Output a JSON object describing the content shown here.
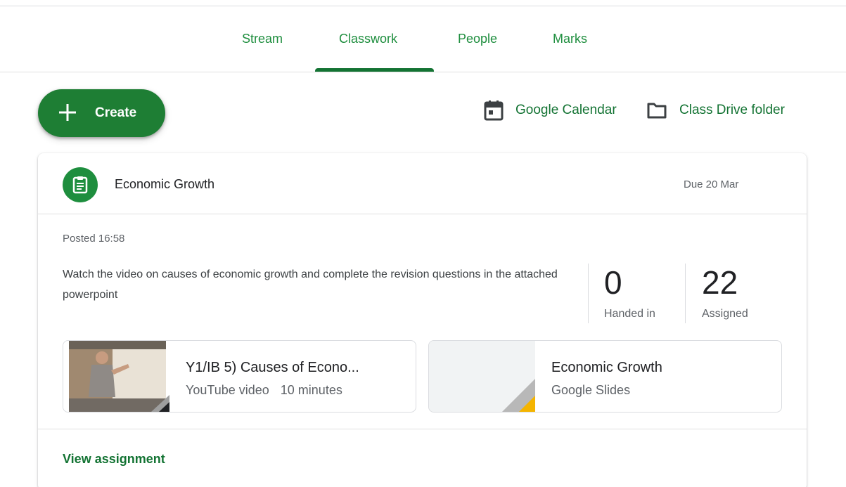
{
  "tabs": [
    {
      "label": "Stream"
    },
    {
      "label": "Classwork",
      "active": true
    },
    {
      "label": "People"
    },
    {
      "label": "Marks"
    }
  ],
  "toolbar": {
    "create_label": "Create",
    "calendar_label": "Google Calendar",
    "drive_label": "Class Drive folder"
  },
  "assignment": {
    "icon": "assignment-icon",
    "title": "Economic Growth",
    "due": "Due 20 Mar",
    "posted": "Posted 16:58",
    "description": "Watch the video on causes of economic growth and complete the revision questions in the attached powerpoint",
    "stats": {
      "handed_in_count": "0",
      "handed_in_label": "Handed in",
      "assigned_count": "22",
      "assigned_label": "Assigned"
    },
    "attachments": [
      {
        "title": "Y1/IB 5) Causes of Econo...",
        "type": "YouTube video",
        "duration": "10 minutes",
        "icon": "youtube-thumbnail"
      },
      {
        "title": "Economic Growth",
        "type": "Google Slides",
        "icon": "slides-thumbnail"
      }
    ],
    "view_label": "View assignment"
  },
  "colors": {
    "brand_green": "#1e7e34",
    "link_green": "#137333",
    "slides_yellow": "#f4b400"
  }
}
